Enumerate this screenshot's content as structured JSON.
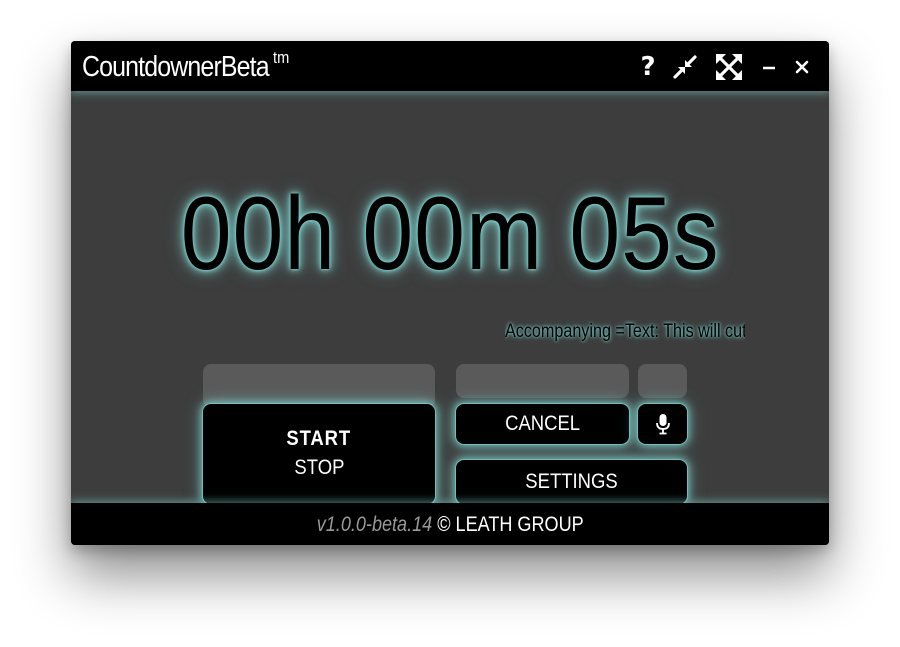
{
  "app": {
    "title": "CountdownerBeta",
    "title_suffix": "tm"
  },
  "titlebar": {
    "help_label": "?",
    "icons": [
      "help-icon",
      "compress-icon",
      "expand-icon",
      "minimize-icon",
      "close-icon"
    ]
  },
  "timer": {
    "display": "00h 00m 05s"
  },
  "accompanying_text": "Accompanying =Text: This will cut o",
  "buttons": {
    "start_label": "START",
    "stop_label": "STOP",
    "cancel_label": "CANCEL",
    "settings_label": "SETTINGS",
    "mic_icon": "microphone-icon"
  },
  "footer": {
    "version": "v1.0.0-beta.14",
    "copyright": "© LEATH GROUP"
  },
  "colors": {
    "glow": "#7fd9d4",
    "background": "#3d3d3d",
    "bar": "#000000",
    "slot": "#5a5a5a"
  }
}
